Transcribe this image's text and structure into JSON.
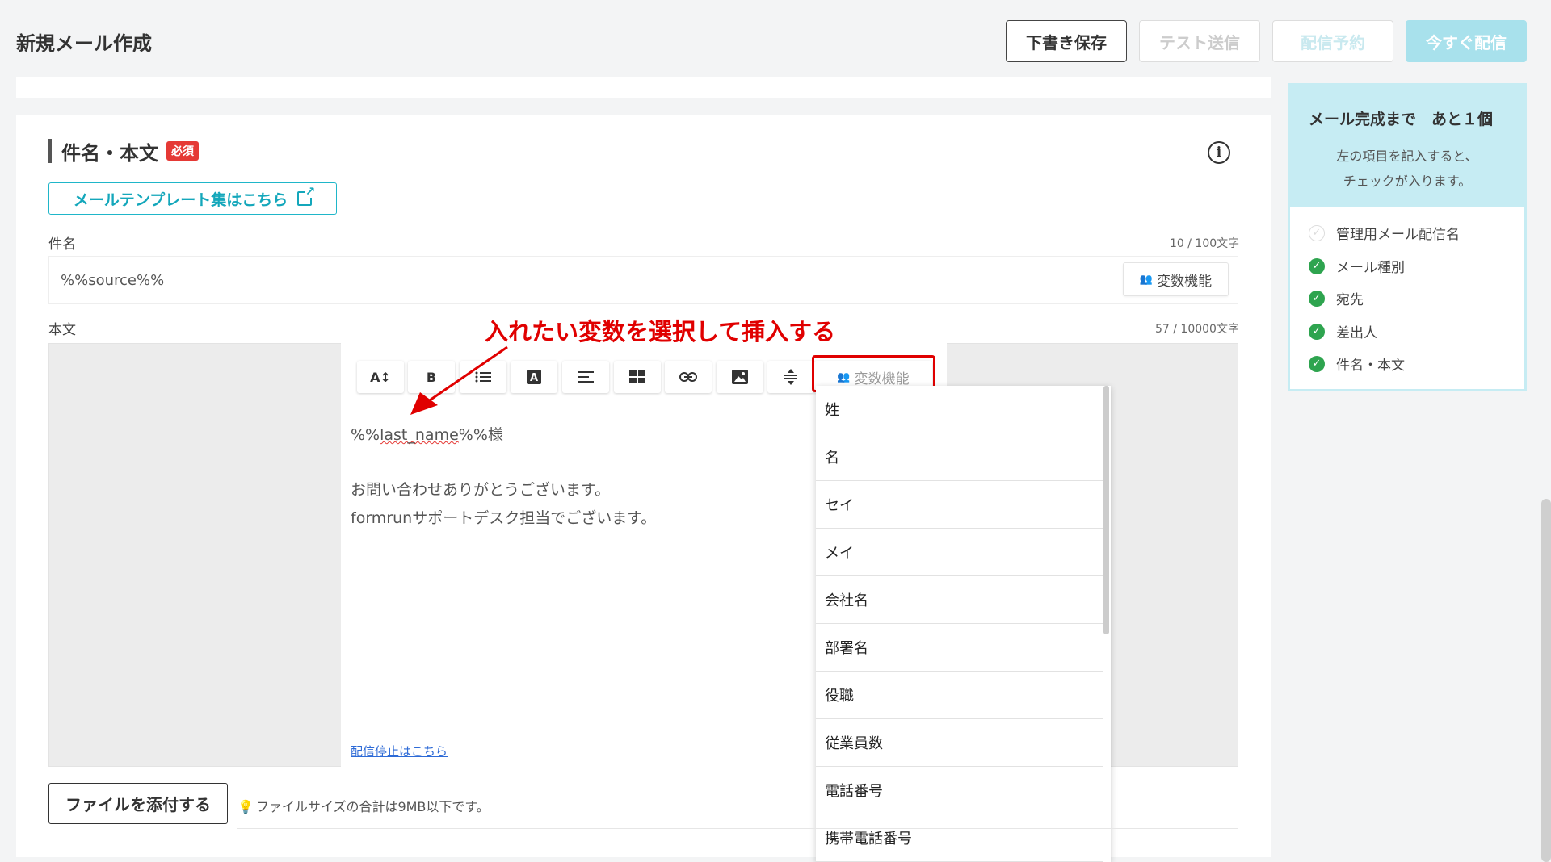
{
  "header": {
    "title": "新規メール作成",
    "draft_label": "下書き保存",
    "test_label": "テスト送信",
    "schedule_label": "配信予約",
    "send_now_label": "今すぐ配信"
  },
  "section": {
    "title": "件名・本文",
    "required_badge": "必須",
    "template_link": "メールテンプレート集はこちら"
  },
  "subject": {
    "label": "件名",
    "counter": "10 / 100文字",
    "value": "%%source%%",
    "var_button": "変数機能"
  },
  "body": {
    "label": "本文",
    "counter": "57 / 10000文字",
    "line1_prefix": "%%",
    "line1_var": "last_name",
    "line1_suffix": "%%様",
    "line2": "お問い合わせありがとうございます。",
    "line3": "formrunサポートデスク担当でございます。",
    "unsubscribe": "配信停止はこちら"
  },
  "toolbar": {
    "font_size": "A↕",
    "bold": "B",
    "var_button": "変数機能"
  },
  "annotation": "入れたい変数を選択して挿入する",
  "dropdown": {
    "items": [
      "姓",
      "名",
      "セイ",
      "メイ",
      "会社名",
      "部署名",
      "役職",
      "従業員数",
      "電話番号",
      "携帯電話番号"
    ]
  },
  "attach": {
    "button": "ファイルを添付する",
    "note": "ファイルサイズの合計は9MB以下です。"
  },
  "sidebar": {
    "title": "メール完成まで　あと１個",
    "desc_line1": "左の項目を記入すると、",
    "desc_line2": "チェックが入ります。",
    "checks": [
      {
        "label": "管理用メール配信名",
        "done": false
      },
      {
        "label": "メール種別",
        "done": true
      },
      {
        "label": "宛先",
        "done": true
      },
      {
        "label": "差出人",
        "done": true
      },
      {
        "label": "件名・本文",
        "done": true
      }
    ]
  }
}
